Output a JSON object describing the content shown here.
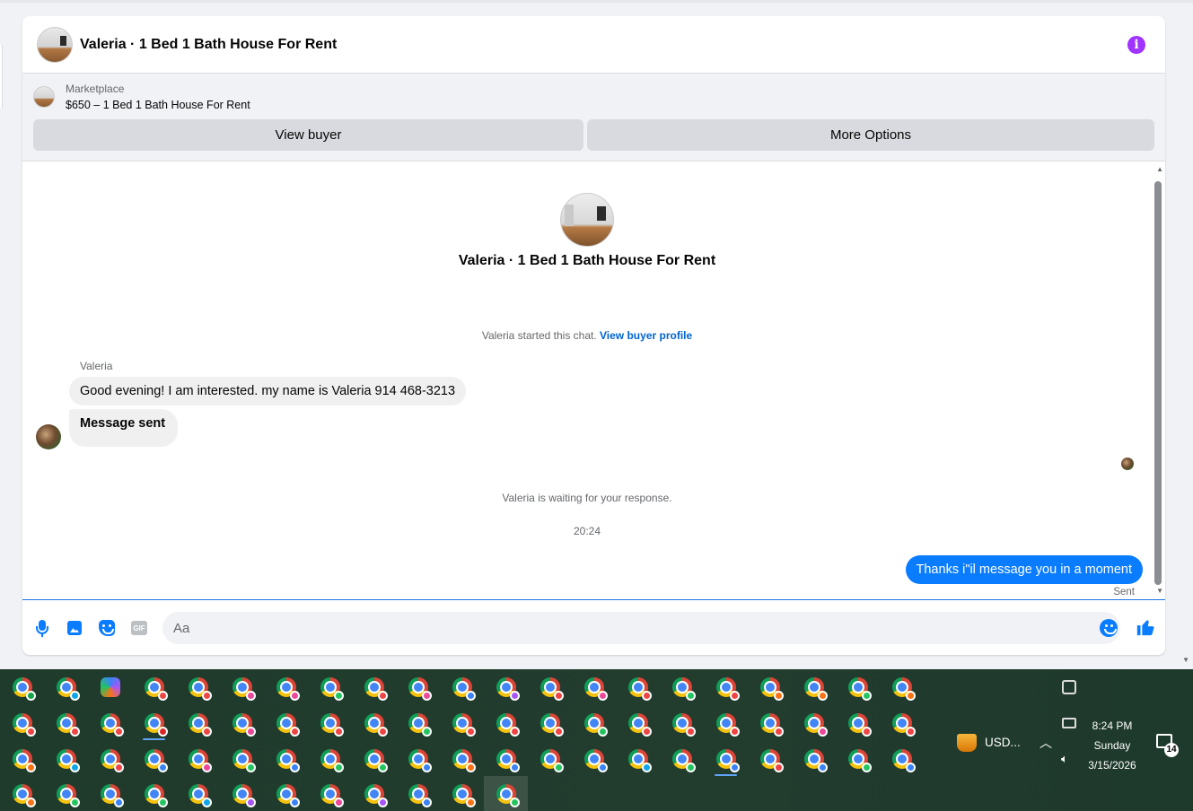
{
  "header": {
    "title": "Valeria · 1 Bed 1 Bath House For Rent",
    "info_icon": "i"
  },
  "marketplace": {
    "label": "Marketplace",
    "listing": "$650 – 1 Bed 1 Bath House For Rent",
    "view_buyer_label": "View buyer",
    "more_options_label": "More Options"
  },
  "thread": {
    "title": "Valeria · 1 Bed 1 Bath House For Rent",
    "started_text": "Valeria started this chat.",
    "view_profile_link": "View buyer profile",
    "sender_name": "Valeria",
    "messages_in": [
      "Good evening! I am interested. my name is Valeria 914 468-3213",
      "Message sent"
    ],
    "waiting_text": "Valeria is waiting for your response.",
    "timestamp": "20:24",
    "message_out": "Thanks i\"il message you in a moment",
    "sent_label": "Sent"
  },
  "composer": {
    "placeholder": "Aa",
    "gif_label": "GIF"
  },
  "taskbar": {
    "usd_label": "USD...",
    "time": "8:24 PM",
    "day": "Sunday",
    "date": "3/15/2026",
    "notification_count": "14"
  },
  "colors": {
    "accent": "#0a7cff",
    "info": "#a033ff",
    "link": "#0064d1"
  }
}
